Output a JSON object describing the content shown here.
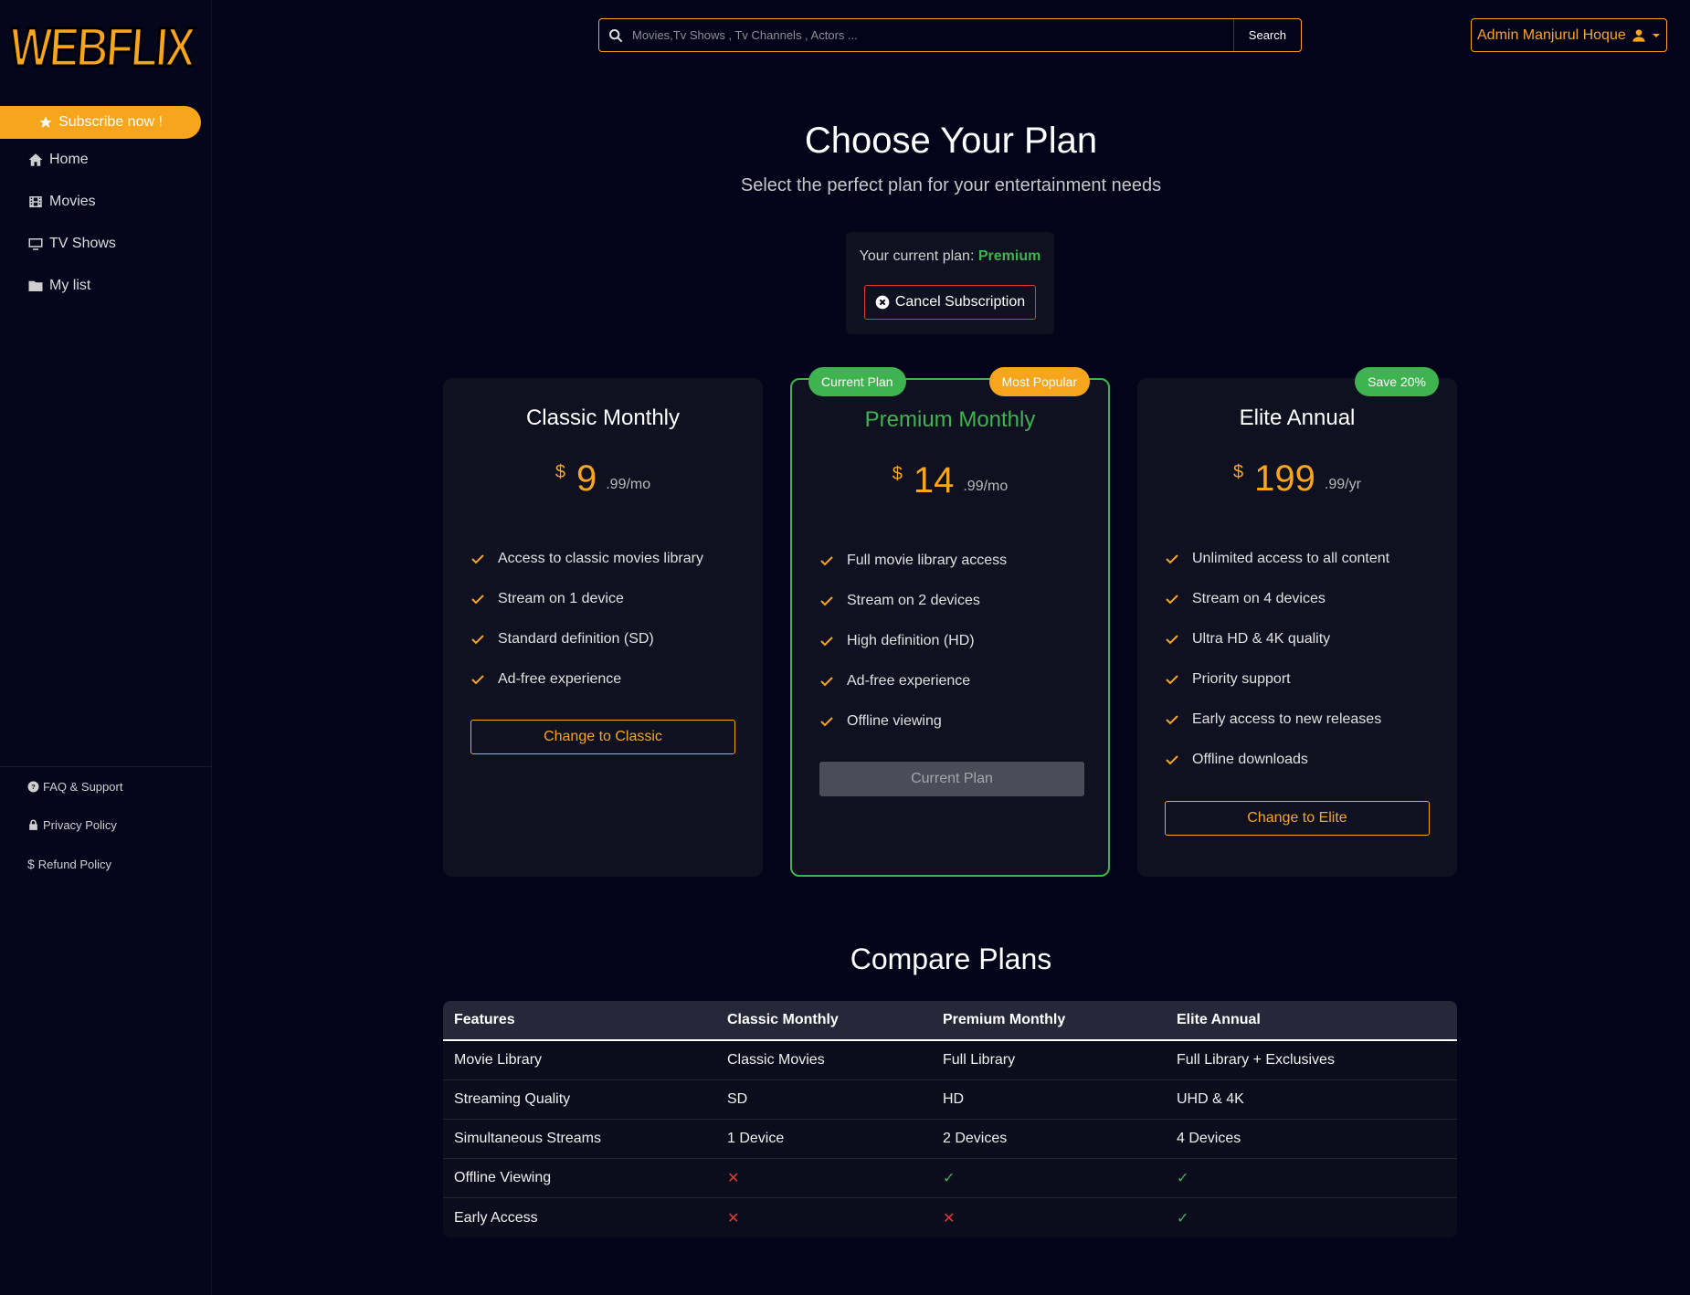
{
  "app": {
    "logo_text": "WEBFLIX"
  },
  "sidebar": {
    "subscribe_label": "Subscribe now !",
    "items": [
      {
        "label": "Home",
        "icon": "home-icon"
      },
      {
        "label": "Movies",
        "icon": "film-icon"
      },
      {
        "label": "TV Shows",
        "icon": "tv-icon"
      },
      {
        "label": "My list",
        "icon": "folder-icon"
      }
    ],
    "footer": [
      {
        "label": "FAQ & Support",
        "icon": "question-circle-icon"
      },
      {
        "label": "Privacy Policy",
        "icon": "lock-icon"
      },
      {
        "label": "Refund Policy",
        "icon": "dollar-icon"
      }
    ]
  },
  "header": {
    "search_placeholder": "Movies,Tv Shows , Tv Channels , Actors ...",
    "search_button": "Search",
    "user_label": "Admin Manjurul Hoque"
  },
  "main": {
    "title": "Choose Your Plan",
    "subtitle": "Select the perfect plan for your entertainment needs",
    "current_plan_prefix": "Your current plan:",
    "current_plan_name": "Premium",
    "cancel_label": "Cancel Subscription"
  },
  "plans": [
    {
      "name": "Classic Monthly",
      "currency": "$",
      "amount": "9",
      "period": ".99/mo",
      "features": [
        "Access to classic movies library",
        "Stream on 1 device",
        "Standard definition (SD)",
        "Ad-free experience"
      ],
      "button": "Change to Classic"
    },
    {
      "name": "Premium Monthly",
      "currency": "$",
      "amount": "14",
      "period": ".99/mo",
      "badge_left": "Current Plan",
      "badge_right": "Most Popular",
      "features": [
        "Full movie library access",
        "Stream on 2 devices",
        "High definition (HD)",
        "Ad-free experience",
        "Offline viewing"
      ],
      "button": "Current Plan"
    },
    {
      "name": "Elite Annual",
      "currency": "$",
      "amount": "199",
      "period": ".99/yr",
      "badge_right": "Save 20%",
      "features": [
        "Unlimited access to all content",
        "Stream on 4 devices",
        "Ultra HD & 4K quality",
        "Priority support",
        "Early access to new releases",
        "Offline downloads"
      ],
      "button": "Change to Elite"
    }
  ],
  "compare": {
    "title": "Compare Plans",
    "headers": [
      "Features",
      "Classic Monthly",
      "Premium Monthly",
      "Elite Annual"
    ],
    "rows": [
      [
        "Movie Library",
        "Classic Movies",
        "Full Library",
        "Full Library + Exclusives"
      ],
      [
        "Streaming Quality",
        "SD",
        "HD",
        "UHD & 4K"
      ],
      [
        "Simultaneous Streams",
        "1 Device",
        "2 Devices",
        "4 Devices"
      ],
      [
        "Offline Viewing",
        "✕",
        "✓",
        "✓"
      ],
      [
        "Early Access",
        "✕",
        "✕",
        "✓"
      ]
    ]
  },
  "colors": {
    "accent": "#f7a51c",
    "success": "#3fb34f",
    "danger": "#e5392f",
    "background": "#03041a"
  }
}
